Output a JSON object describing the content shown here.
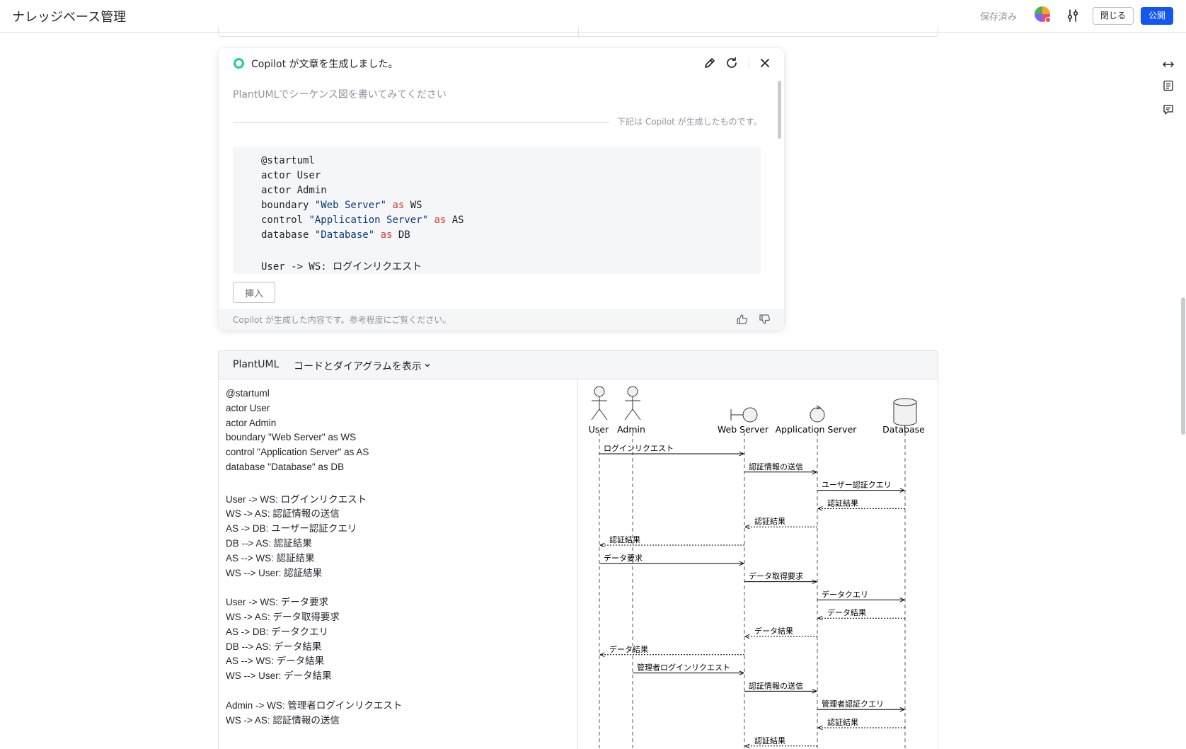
{
  "header": {
    "title": "ナレッジベース管理",
    "saved_status": "保存済み",
    "close_label": "閉じる",
    "publish_label": "公開"
  },
  "copilot": {
    "title": "Copilot が文章を生成しました。",
    "prompt": "PlantUMLでシーケンス図を書いてみてください",
    "generated_note": "下記は Copilot が生成したものです。",
    "code_lines": [
      "@startuml",
      "actor User",
      "actor Admin",
      "boundary \"Web Server\" as WS",
      "control \"Application Server\" as AS",
      "database \"Database\" as DB",
      "",
      "User -> WS: ログインリクエスト"
    ],
    "insert_label": "挿入",
    "disclaimer": "Copilot が生成した内容です。参考程度にご覧ください。"
  },
  "plantuml": {
    "label": "PlantUML",
    "mode": "コードとダイアグラムを表示",
    "source_lines": [
      "@startuml",
      "actor User",
      "actor Admin",
      "boundary \"Web Server\" as WS",
      "control \"Application Server\" as AS",
      "database \"Database\" as DB",
      "",
      "User -> WS: ログインリクエスト",
      "WS -> AS: 認証情報の送信",
      "AS -> DB: ユーザー認証クエリ",
      "DB --> AS: 認証結果",
      "AS --> WS: 認証結果",
      "WS --> User: 認証結果",
      "",
      "User -> WS: データ要求",
      "WS -> AS: データ取得要求",
      "AS -> DB: データクエリ",
      "DB --> AS: データ結果",
      "AS --> WS: データ結果",
      "WS --> User: データ結果",
      "",
      "Admin -> WS: 管理者ログインリクエスト",
      "WS -> AS: 認証情報の送信"
    ],
    "diagram": {
      "participants": [
        {
          "id": "User",
          "label": "User",
          "kind": "actor"
        },
        {
          "id": "Admin",
          "label": "Admin",
          "kind": "actor"
        },
        {
          "id": "WS",
          "label": "Web Server",
          "kind": "boundary"
        },
        {
          "id": "AS",
          "label": "Application Server",
          "kind": "control"
        },
        {
          "id": "DB",
          "label": "Database",
          "kind": "database"
        }
      ],
      "messages": [
        {
          "from": "User",
          "to": "WS",
          "label": "ログインリクエスト",
          "dashed": false
        },
        {
          "from": "WS",
          "to": "AS",
          "label": "認証情報の送信",
          "dashed": false
        },
        {
          "from": "AS",
          "to": "DB",
          "label": "ユーザー認証クエリ",
          "dashed": false
        },
        {
          "from": "DB",
          "to": "AS",
          "label": "認証結果",
          "dashed": true
        },
        {
          "from": "AS",
          "to": "WS",
          "label": "認証結果",
          "dashed": true
        },
        {
          "from": "WS",
          "to": "User",
          "label": "認証結果",
          "dashed": true
        },
        {
          "from": "User",
          "to": "WS",
          "label": "データ要求",
          "dashed": false
        },
        {
          "from": "WS",
          "to": "AS",
          "label": "データ取得要求",
          "dashed": false
        },
        {
          "from": "AS",
          "to": "DB",
          "label": "データクエリ",
          "dashed": false
        },
        {
          "from": "DB",
          "to": "AS",
          "label": "データ結果",
          "dashed": true
        },
        {
          "from": "AS",
          "to": "WS",
          "label": "データ結果",
          "dashed": true
        },
        {
          "from": "WS",
          "to": "User",
          "label": "データ結果",
          "dashed": true
        },
        {
          "from": "Admin",
          "to": "WS",
          "label": "管理者ログインリクエスト",
          "dashed": false
        },
        {
          "from": "WS",
          "to": "AS",
          "label": "認証情報の送信",
          "dashed": false
        },
        {
          "from": "AS",
          "to": "DB",
          "label": "管理者認証クエリ",
          "dashed": false
        },
        {
          "from": "DB",
          "to": "AS",
          "label": "認証結果",
          "dashed": true
        },
        {
          "from": "AS",
          "to": "WS",
          "label": "認証結果",
          "dashed": true
        }
      ]
    }
  },
  "icons": {
    "settings": "sliders-icon",
    "edit": "pencil-icon",
    "regenerate": "refresh-icon",
    "close": "close-icon",
    "like": "thumbs-up-icon",
    "dislike": "thumbs-down-icon",
    "rail": [
      "expand-width-icon",
      "outline-icon",
      "comments-icon"
    ]
  },
  "colors": {
    "accent": "#1456f0",
    "copilot_status": "#1fc8a5",
    "code_string": "#0b3a78",
    "code_keyword": "#d83931"
  }
}
